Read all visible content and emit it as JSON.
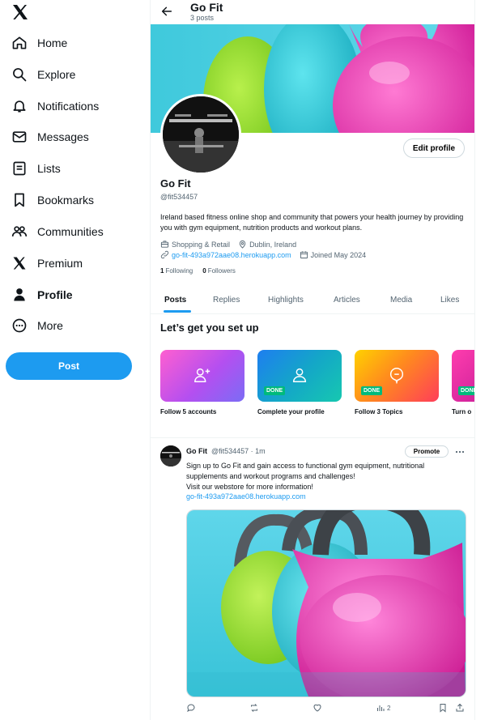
{
  "sidebar": {
    "items": [
      {
        "label": "Home"
      },
      {
        "label": "Explore"
      },
      {
        "label": "Notifications"
      },
      {
        "label": "Messages"
      },
      {
        "label": "Lists"
      },
      {
        "label": "Bookmarks"
      },
      {
        "label": "Communities"
      },
      {
        "label": "Premium"
      },
      {
        "label": "Profile"
      },
      {
        "label": "More"
      }
    ],
    "post_label": "Post"
  },
  "header": {
    "title": "Go Fit",
    "subtitle": "3 posts"
  },
  "profile": {
    "edit_label": "Edit profile",
    "name": "Go Fit",
    "handle": "@fit534457",
    "bio": "Ireland based fitness online shop and community that powers your health journey by providing you with gym equipment, nutrition products and workout plans.",
    "category": "Shopping & Retail",
    "location": "Dublin, Ireland",
    "website": "go-fit-493a972aae08.herokuapp.com",
    "joined": "Joined May 2024",
    "following_count": "1",
    "following_label": "Following",
    "followers_count": "0",
    "followers_label": "Followers"
  },
  "tabs": [
    {
      "label": "Posts"
    },
    {
      "label": "Replies"
    },
    {
      "label": "Highlights"
    },
    {
      "label": "Articles"
    },
    {
      "label": "Media"
    },
    {
      "label": "Likes"
    }
  ],
  "setup": {
    "title": "Let’s get you set up",
    "cards": [
      {
        "label": "Follow 5 accounts",
        "done": false
      },
      {
        "label": "Complete your profile",
        "done": true
      },
      {
        "label": "Follow 3 Topics",
        "done": true
      },
      {
        "label": "Turn o",
        "done": true
      }
    ],
    "done_label": "DONE"
  },
  "tweet": {
    "name": "Go Fit",
    "handle_time": "@fit534457 · 1m",
    "promote_label": "Promote",
    "text": "Sign up to Go Fit and gain access to functional gym equipment, nutritional supplements and workout programs and challenges!\nVisit our webstore for more information!",
    "link": "go-fit-493a972aae08.herokuapp.com",
    "views": "2"
  },
  "colors": {
    "accent": "#1d9bf0",
    "done": "#00ba7c",
    "text": "#0f1419",
    "muted": "#536471"
  }
}
